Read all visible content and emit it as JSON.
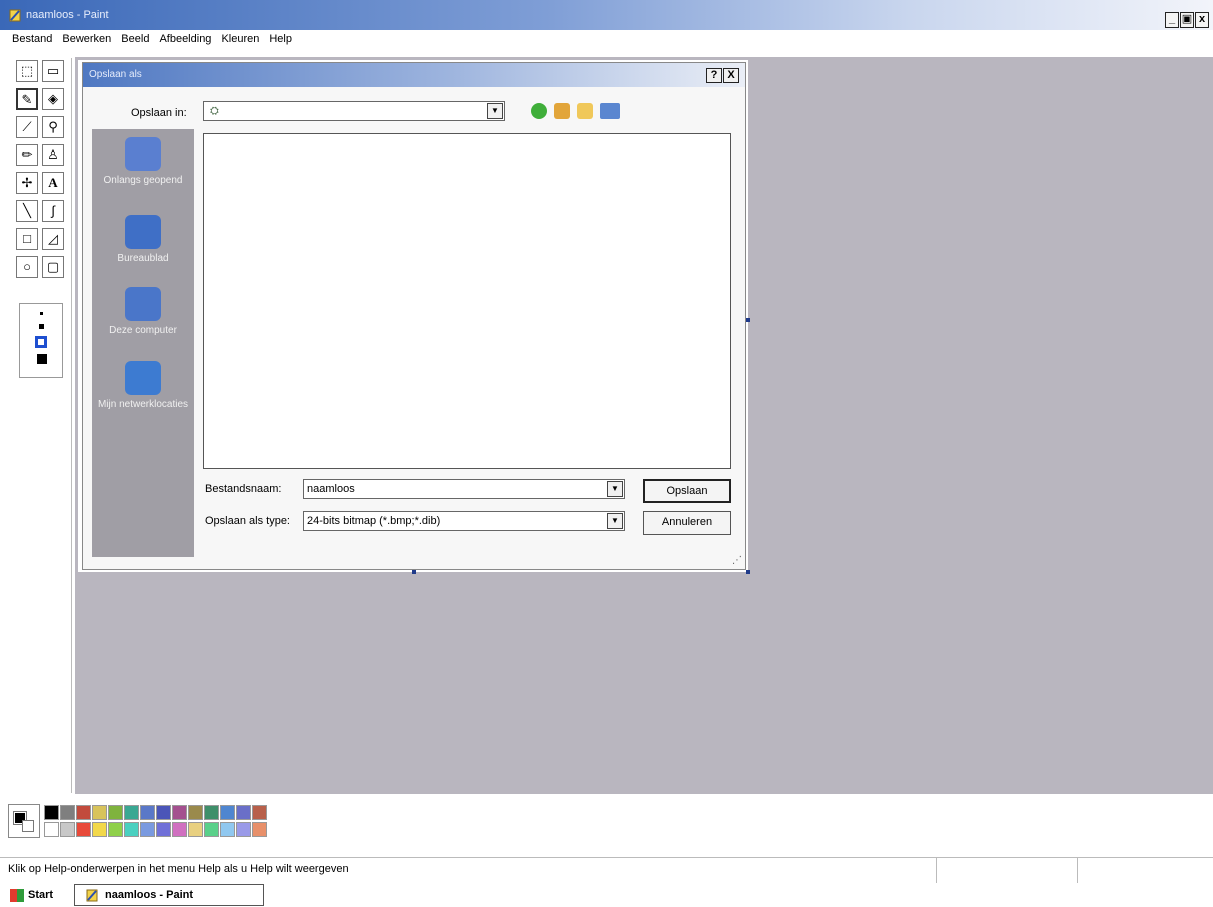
{
  "window": {
    "title": "naamloos - Paint",
    "minimize": "_",
    "maximize": "▣",
    "close": "x"
  },
  "menu": [
    "Bestand",
    "Bewerken",
    "Beeld",
    "Afbeelding",
    "Kleuren",
    "Help"
  ],
  "tools": [
    {
      "name": "free-select",
      "glyph": "⬚"
    },
    {
      "name": "rect-select",
      "glyph": "▭"
    },
    {
      "name": "eraser",
      "glyph": "✎"
    },
    {
      "name": "fill",
      "glyph": "◈"
    },
    {
      "name": "color-picker",
      "glyph": "⟋"
    },
    {
      "name": "magnifier",
      "glyph": "⚲"
    },
    {
      "name": "pencil",
      "glyph": "✏"
    },
    {
      "name": "brush",
      "glyph": "♙"
    },
    {
      "name": "airbrush",
      "glyph": "✢"
    },
    {
      "name": "text",
      "glyph": "A"
    },
    {
      "name": "line",
      "glyph": "╲"
    },
    {
      "name": "curve",
      "glyph": "∫"
    },
    {
      "name": "rectangle",
      "glyph": "□"
    },
    {
      "name": "polygon",
      "glyph": "◿"
    },
    {
      "name": "ellipse",
      "glyph": "○"
    },
    {
      "name": "rounded-rect",
      "glyph": "▢"
    }
  ],
  "dialog": {
    "title": "Opslaan als",
    "help": "?",
    "close": "X",
    "save_in_label": "Opslaan in:",
    "save_in_value": "",
    "places": [
      {
        "label": "Onlangs geopend",
        "color": "#5a7fd0"
      },
      {
        "label": "Bureaublad",
        "color": "#3f6fc6"
      },
      {
        "label": "Deze computer",
        "color": "#4a76c9"
      },
      {
        "label": "Mijn netwerklocaties",
        "color": "#3d7bd1"
      }
    ],
    "filename_label": "Bestandsnaam:",
    "filename_value": "naamloos",
    "filetype_label": "Opslaan als type:",
    "filetype_value": "24-bits bitmap (*.bmp;*.dib)",
    "save_button": "Opslaan",
    "cancel_button": "Annuleren"
  },
  "palette": {
    "colors": [
      "#000000",
      "#7f7f7f",
      "#c24b3d",
      "#d8c35b",
      "#7fb33e",
      "#3aa893",
      "#5a78c8",
      "#4b55b8",
      "#a4508f",
      "#9a8a4c",
      "#3f8f6a",
      "#4f86d0",
      "#6a6fc8",
      "#b8604a",
      "#ffffff",
      "#c8c8c8",
      "#e84a3a",
      "#f2d84a",
      "#8fd04a",
      "#4ad0c0",
      "#7a9ae0",
      "#7070d8",
      "#d070c0",
      "#e8d080",
      "#5ad08a",
      "#90c8f0",
      "#9a9ae8",
      "#e8906a"
    ]
  },
  "status": {
    "text": "Klik op Help-onderwerpen in het menu Help als u Help wilt weergeven"
  },
  "taskbar": {
    "start": "Start",
    "task": "naamloos - Paint"
  }
}
